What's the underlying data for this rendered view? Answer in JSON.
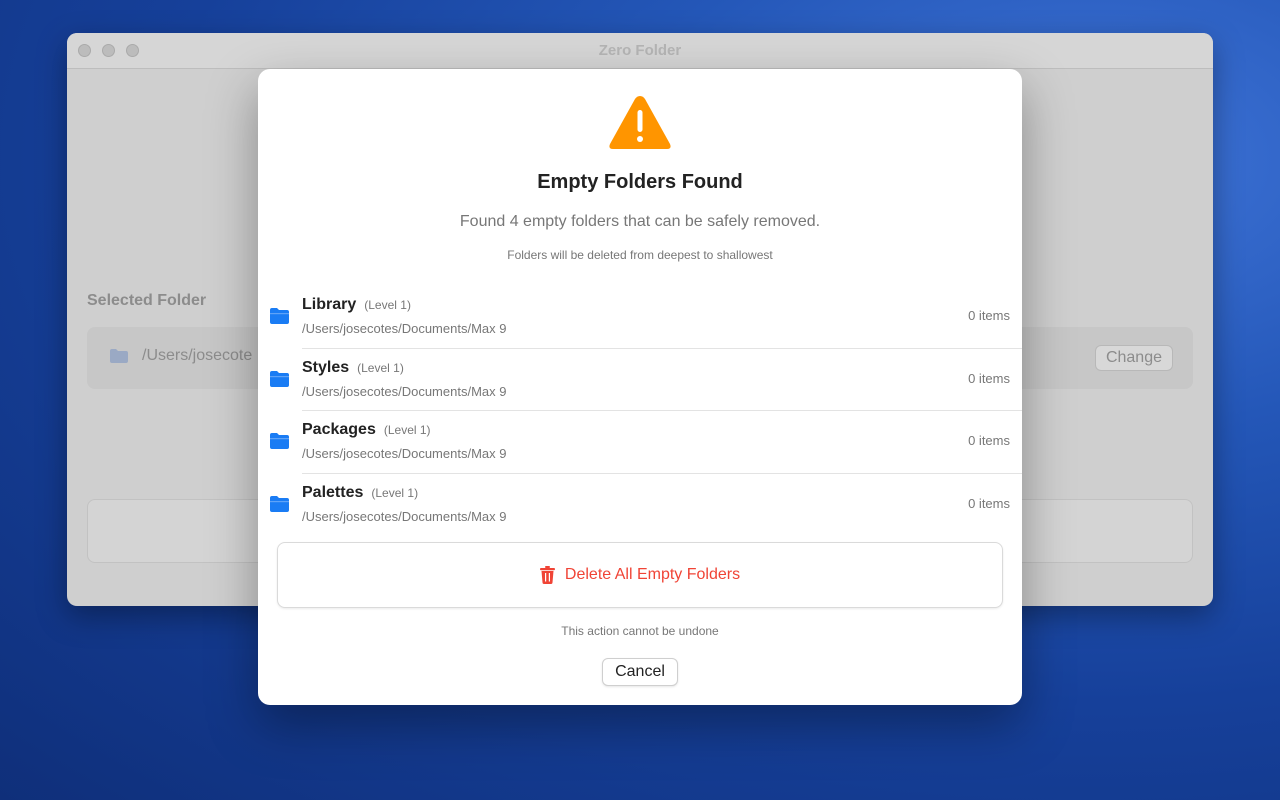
{
  "background_window": {
    "title": "Zero Folder",
    "selected_folder_label": "Selected Folder",
    "selected_path": "/Users/josecote",
    "change_label": "Change"
  },
  "dialog": {
    "title": "Empty Folders Found",
    "subtitle": "Found 4 empty folders that can be safely removed.",
    "note": "Folders will be deleted from deepest to shallowest",
    "folders": [
      {
        "name": "Library",
        "level": "(Level 1)",
        "path": "/Users/josecotes/Documents/Max 9",
        "count": "0 items"
      },
      {
        "name": "Styles",
        "level": "(Level 1)",
        "path": "/Users/josecotes/Documents/Max 9",
        "count": "0 items"
      },
      {
        "name": "Packages",
        "level": "(Level 1)",
        "path": "/Users/josecotes/Documents/Max 9",
        "count": "0 items"
      },
      {
        "name": "Palettes",
        "level": "(Level 1)",
        "path": "/Users/josecotes/Documents/Max 9",
        "count": "0 items"
      }
    ],
    "delete_label": "Delete All Empty Folders",
    "undo_note": "This action cannot be undone",
    "cancel_label": "Cancel"
  },
  "icons": {
    "warning": "warning-triangle-icon",
    "folder": "folder-icon",
    "trash": "trash-icon"
  },
  "colors": {
    "warning": "#ff9500",
    "folder": "#1a7cf4",
    "destructive": "#f04436"
  }
}
